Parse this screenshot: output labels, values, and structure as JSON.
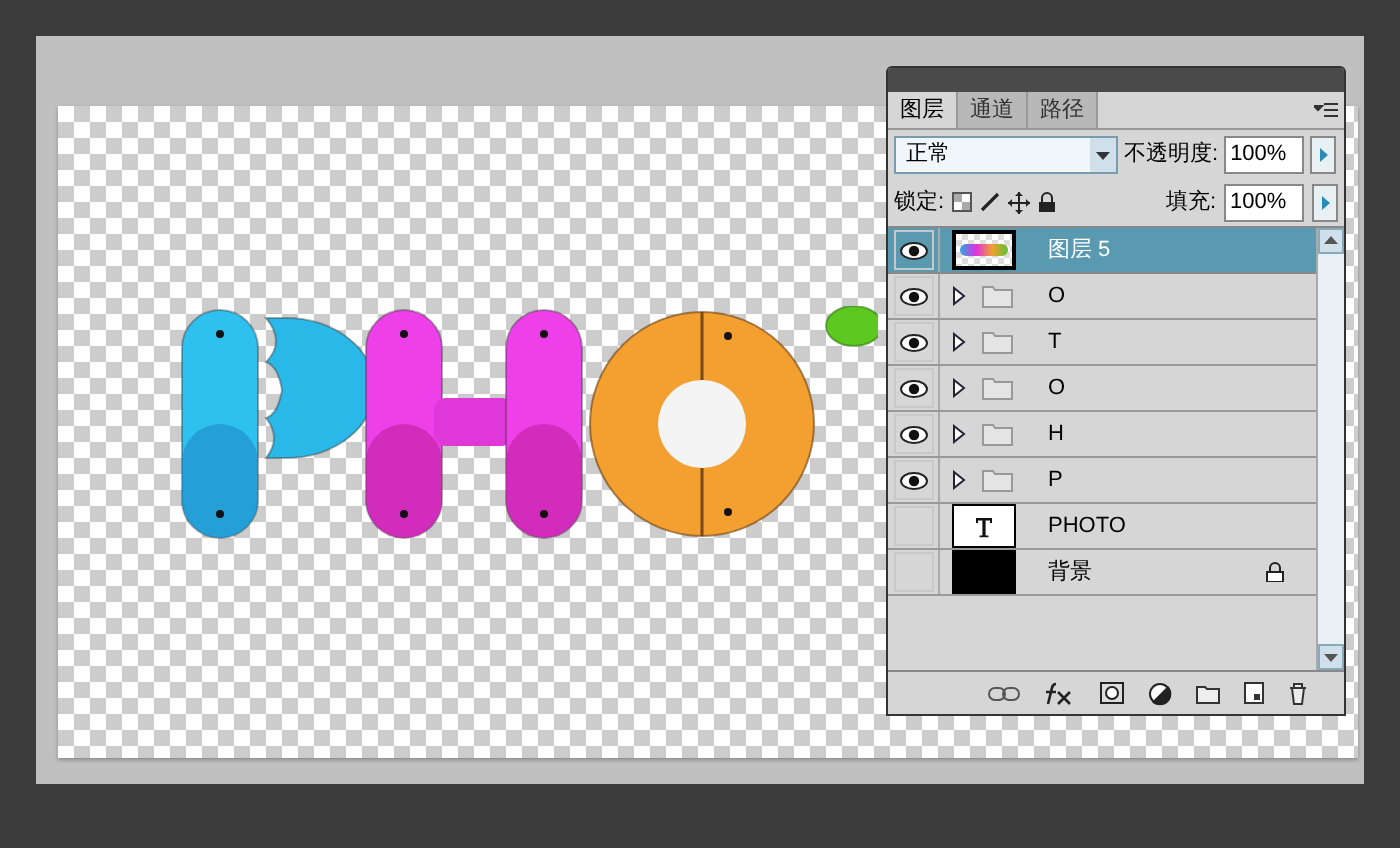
{
  "layers_panel": {
    "tabs": [
      {
        "label": "图层",
        "selected": true
      },
      {
        "label": "通道",
        "selected": false
      },
      {
        "label": "路径",
        "selected": false
      }
    ],
    "blend_mode": "正常",
    "opacity_label": "不透明度:",
    "opacity": "100%",
    "lock_label": "锁定:",
    "fill_label": "填充:",
    "fill": "100%",
    "layers": [
      {
        "name": "图层 5",
        "kind": "image",
        "visible": true,
        "selected": true,
        "locked": false
      },
      {
        "name": "O",
        "kind": "group",
        "visible": true,
        "selected": false,
        "locked": false
      },
      {
        "name": "T",
        "kind": "group",
        "visible": true,
        "selected": false,
        "locked": false
      },
      {
        "name": "O",
        "kind": "group",
        "visible": true,
        "selected": false,
        "locked": false
      },
      {
        "name": "H",
        "kind": "group",
        "visible": true,
        "selected": false,
        "locked": false
      },
      {
        "name": "P",
        "kind": "group",
        "visible": true,
        "selected": false,
        "locked": false
      },
      {
        "name": "PHOTO",
        "kind": "text",
        "visible": false,
        "selected": false,
        "locked": false
      },
      {
        "name": "背景",
        "kind": "fill",
        "visible": false,
        "selected": false,
        "locked": true
      }
    ]
  }
}
